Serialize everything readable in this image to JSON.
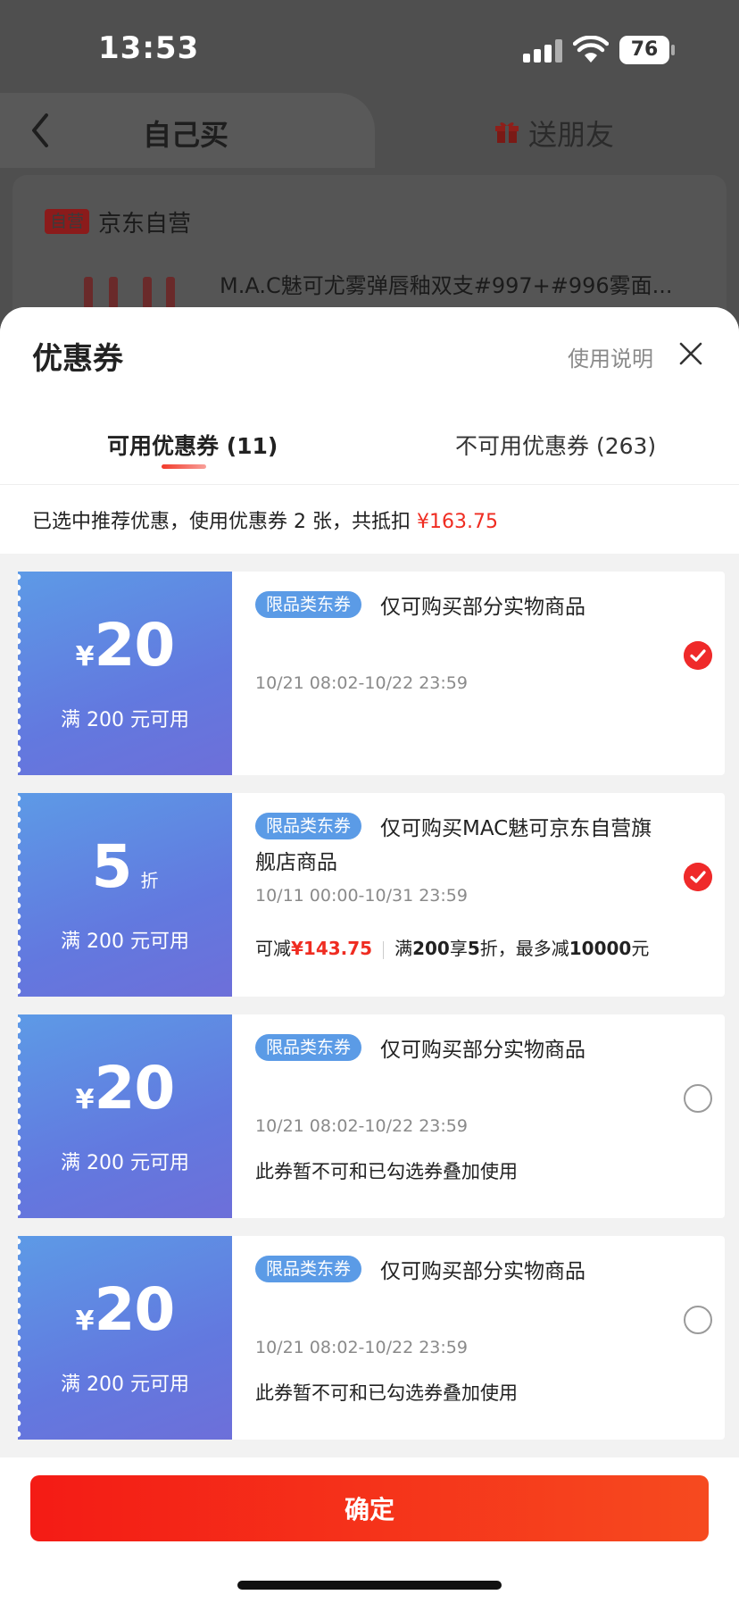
{
  "status_bar": {
    "time": "13:53",
    "battery": "76"
  },
  "header": {
    "tab_self": "自己买",
    "tab_gift": "送朋友"
  },
  "store": {
    "badge": "自营",
    "name": "京东自营",
    "product_title": "M.A.C魅可尤雾弹唇釉双支#997+#996雾面..."
  },
  "sheet": {
    "title": "优惠券",
    "usage_link": "使用说明",
    "tabs": {
      "available": "可用优惠券 (11)",
      "unavailable": "不可用优惠券 (263)"
    },
    "summary_prefix": "已选中推荐优惠，使用优惠券 2 张，共抵扣 ",
    "summary_amount": "¥163.75"
  },
  "coupons": [
    {
      "currency": "¥",
      "amount": "20",
      "unit": "",
      "min_spend": "满 200 元可用",
      "tag": "限品类东券",
      "desc": "仅可购买部分实物商品",
      "desc_line2": "",
      "date": "10/21 08:02-10/22 23:59",
      "note": "",
      "selected": true
    },
    {
      "currency": "",
      "amount": "5",
      "unit": "折",
      "min_spend": "满 200 元可用",
      "tag": "限品类东券",
      "desc": "仅可购买MAC魅可京东自营旗",
      "desc_line2": "舰店商品",
      "date": "10/11 00:00-10/31 23:59",
      "save_label": "可减",
      "save_amount": "¥143.75",
      "rule_prefix": "满",
      "rule_threshold": "200",
      "rule_mid": "享",
      "rule_rate": "5",
      "rule_unit": "折，最多减",
      "rule_cap": "10000",
      "rule_suffix": "元",
      "selected": true
    },
    {
      "currency": "¥",
      "amount": "20",
      "unit": "",
      "min_spend": "满 200 元可用",
      "tag": "限品类东券",
      "desc": "仅可购买部分实物商品",
      "desc_line2": "",
      "date": "10/21 08:02-10/22 23:59",
      "note": "此券暂不可和已勾选券叠加使用",
      "selected": false
    },
    {
      "currency": "¥",
      "amount": "20",
      "unit": "",
      "min_spend": "满 200 元可用",
      "tag": "限品类东券",
      "desc": "仅可购买部分实物商品",
      "desc_line2": "",
      "date": "10/21 08:02-10/22 23:59",
      "note": "此券暂不可和已勾选券叠加使用",
      "selected": false
    }
  ],
  "footer": {
    "confirm_label": "确定"
  },
  "watermark": "shopping",
  "colors": {
    "accent_red": "#ef2c21",
    "coupon_blue": "#5d9ae6",
    "tag_blue": "#5b9be6"
  }
}
